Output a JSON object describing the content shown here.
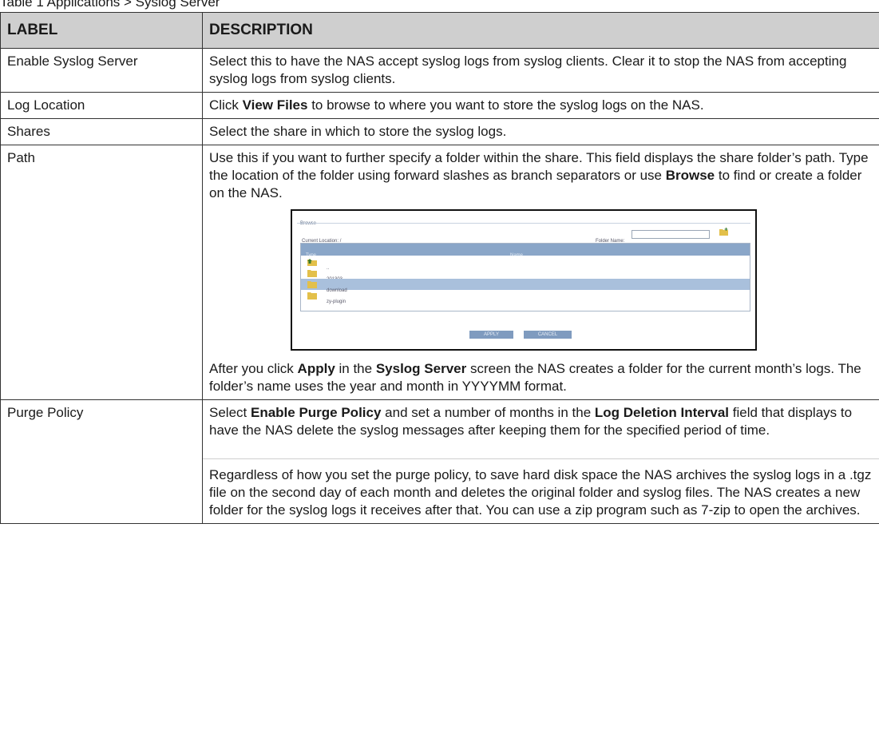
{
  "caption": "Table 1 Applications > Syslog Server",
  "table": {
    "headers": [
      "LABEL",
      "DESCRIPTION"
    ],
    "rows": {
      "enable": {
        "label": "Enable Syslog Server",
        "desc": "Select this to have the NAS accept syslog logs from syslog clients. Clear it to stop the NAS from accepting syslog logs from syslog clients."
      },
      "location": {
        "label": "Log Location",
        "desc_prefix": "Click ",
        "desc_bold": "View Files",
        "desc_suffix": " to browse to where you want to store the syslog logs on the NAS."
      },
      "shares": {
        "label": "Shares",
        "desc": "Select the share in which to store the syslog logs."
      },
      "path": {
        "label": "Path",
        "desc_prefix": "Use this if you want to further specify a folder within the share. This field displays the share folder’s path. Type the location of the folder using forward slashes as branch separators or use ",
        "desc_bold": "Browse",
        "desc_suffix": " to find or create a folder on the NAS.",
        "after_prefix": "After you click ",
        "after_bold1": "Apply",
        "after_mid": " in the ",
        "after_bold2": "Syslog Server",
        "after_suffix": " screen the NAS creates a folder for the current month’s logs. The folder’s name uses the year and month in YYYYMM format."
      },
      "purge": {
        "label": "Purge Policy",
        "p1_prefix": "Select ",
        "p1_bold1": "Enable Purge Policy",
        "p1_mid": " and set a number of months in the ",
        "p1_bold2": "Log Deletion Interval",
        "p1_suffix": " field that displays to have the NAS delete the syslog messages after keeping them for the specified period of time.",
        "p2": "Regardless of how you set the purge policy, to save hard disk space the NAS archives the syslog logs in a .tgz file on the second day of each month and deletes the original folder and syslog files. The NAS creates a new folder for the syslog logs it receives after that. You can use a zip program such as 7-zip to open the archives."
      }
    }
  },
  "browse_dialog": {
    "title": "Browse",
    "current_location": "Current Location: /",
    "folder_name_label": "Folder Name:",
    "column_type": "Type",
    "column_name": "Name",
    "items": [
      "..",
      "201303",
      "download",
      "zy-plugin"
    ],
    "selected_index": 2,
    "apply_label": "APPLY",
    "cancel_label": "CANCEL",
    "colors": {
      "header": "#8aa6c8",
      "selected_row": "#a9c0dc",
      "folder": "#e3c04a",
      "button": "#7f9bbf"
    }
  }
}
